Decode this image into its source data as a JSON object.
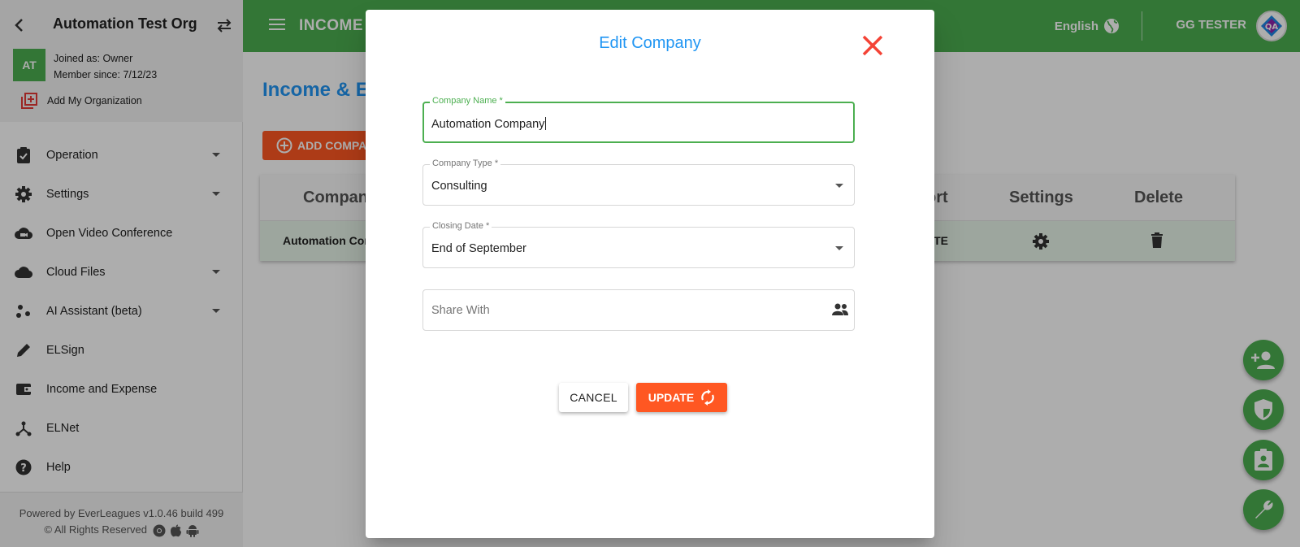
{
  "sidebar": {
    "org_name": "Automation Test Org",
    "avatar_initials": "AT",
    "joined_as": "Joined as: Owner",
    "member_since": "Member since: 7/12/23",
    "add_org_label": "Add My Organization",
    "items": [
      {
        "label": "Operation",
        "icon": "clipboard-check-icon",
        "has_submenu": true
      },
      {
        "label": "Settings",
        "icon": "gear-icon",
        "has_submenu": true
      },
      {
        "label": "Open Video Conference",
        "icon": "video-cloud-icon",
        "has_submenu": false
      },
      {
        "label": "Cloud Files",
        "icon": "cloud-icon",
        "has_submenu": true
      },
      {
        "label": "AI Assistant (beta)",
        "icon": "dots-cluster-icon",
        "has_submenu": true
      },
      {
        "label": "ELSign",
        "icon": "pencil-icon",
        "has_submenu": false
      },
      {
        "label": "Income and Expense",
        "icon": "wallet-icon",
        "has_submenu": false
      },
      {
        "label": "ELNet",
        "icon": "network-icon",
        "has_submenu": false
      },
      {
        "label": "Help",
        "icon": "help-circle-icon",
        "has_submenu": false
      }
    ],
    "footer_powered": "Powered by EverLeagues v1.0.46 build 499",
    "footer_rights": "© All Rights Reserved"
  },
  "topbar": {
    "title": "INCOME A",
    "language": "English",
    "user_name": "GG TESTER"
  },
  "main": {
    "page_title": "Income & E",
    "add_button_label": "ADD COMPAN",
    "table": {
      "headers": [
        "Company",
        "ort",
        "Settings",
        "Delete"
      ],
      "row": {
        "company": "Automation Com",
        "update": "ATE"
      }
    }
  },
  "dialog": {
    "title": "Edit Company",
    "fields": {
      "company_name": {
        "label": "Company Name *",
        "value": "Automation Company"
      },
      "company_type": {
        "label": "Company Type *",
        "value": "Consulting"
      },
      "closing_date": {
        "label": "Closing Date *",
        "value": "End of September"
      },
      "share_with": {
        "placeholder": "Share With"
      }
    },
    "cancel_label": "CANCEL",
    "update_label": "UPDATE"
  },
  "colors": {
    "brand_green": "#4caf50",
    "accent_orange": "#ff5722",
    "title_blue": "#2196f3",
    "close_red": "#f44336"
  }
}
